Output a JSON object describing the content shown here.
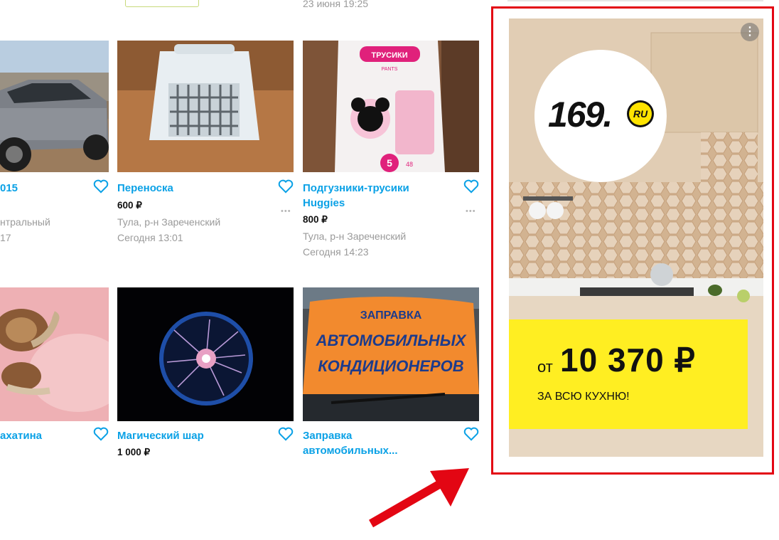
{
  "top": {
    "date_3": "23 июня 19:25"
  },
  "listings": [
    {
      "title": "015",
      "price": "",
      "location": "нтральный",
      "date": "17"
    },
    {
      "title": "Переноска",
      "price": "600 ₽",
      "location": "Тула, р-н Зареченский",
      "date": "Сегодня 13:01"
    },
    {
      "title_line1": "Подгузники-трусики",
      "title_line2": "Huggies",
      "price": "800 ₽",
      "location": "Тула, р-н Зареченский",
      "date": "Сегодня 14:23"
    },
    {
      "title": "ахатина"
    },
    {
      "title": "Магический шар",
      "price": "1 000 ₽"
    },
    {
      "title_line1": "Заправка",
      "title_line2": "автомобильных..."
    }
  ],
  "photos": {
    "diapers_label_1": "ТРУСИКИ",
    "diapers_label_2": "PANTS",
    "diapers_size": "5",
    "diapers_count": "48",
    "sign_line1": "ЗАПРАВКА",
    "sign_line2": "АВТОМОБИЛЬНЫХ",
    "sign_line3": "КОНДИЦИОНЕРОВ"
  },
  "ad": {
    "logo_text": "169.",
    "logo_badge": "RU",
    "more_label": "⋮",
    "price_prefix": "от",
    "price": "10 370 ₽",
    "subtitle": "ЗА ВСЮ КУХНЮ!"
  },
  "colors": {
    "link": "#0aa1e6",
    "highlight_frame": "#e30613",
    "promo_yellow": "#ffee22"
  },
  "icons": [
    "heart-icon",
    "more-dots-icon",
    "kebab-menu-icon",
    "red-arrow"
  ]
}
